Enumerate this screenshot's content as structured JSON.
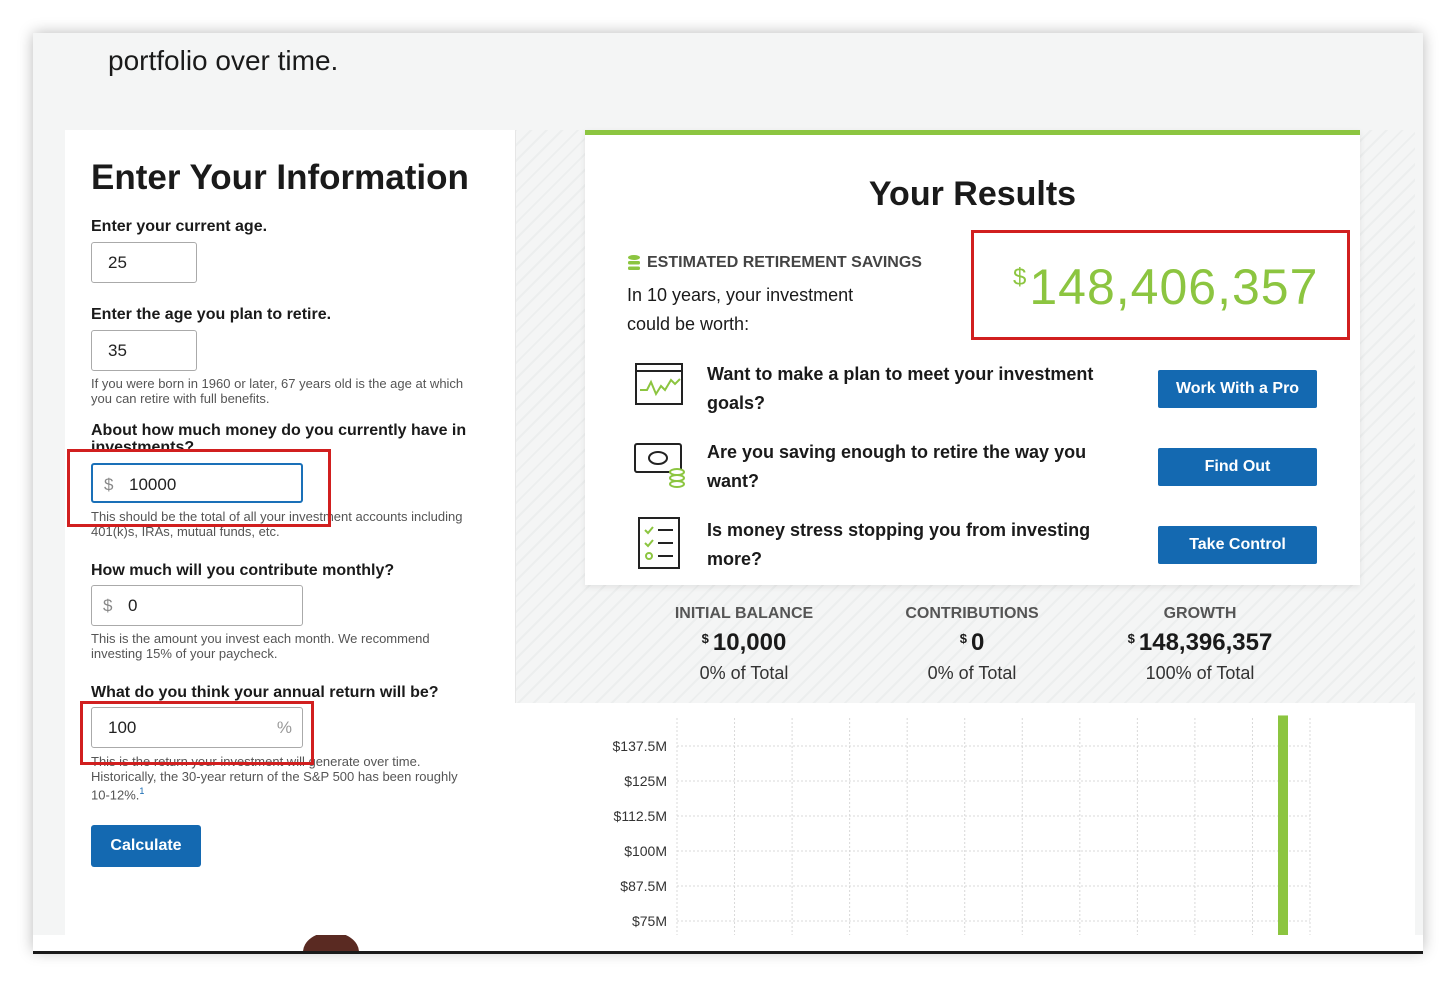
{
  "intro_text": "portfolio over time.",
  "form": {
    "title": "Enter Your Information",
    "age_label": "Enter your current age.",
    "age_value": "25",
    "retire_label": "Enter the age you plan to retire.",
    "retire_value": "35",
    "retire_help": "If you were born in 1960 or later, 67 years old is the age at which you can retire with full benefits.",
    "current_label": "About how much money do you currently have in investments?",
    "currency_symbol": "$",
    "current_value": "10000",
    "current_help": "This should be the total of all your investment accounts including 401(k)s, IRAs, mutual funds, etc.",
    "monthly_label": "How much will you contribute monthly?",
    "monthly_value": "0",
    "monthly_help": "This is the amount you invest each month. We recommend investing 15% of your paycheck.",
    "return_label": "What do you think your annual return will be?",
    "return_value": "100",
    "percent_symbol": "%",
    "return_help": "This is the return your investment will generate over time. Historically, the 30-year return of the S&P 500 has been roughly 10-12%.",
    "footnote": "1",
    "calculate_label": "Calculate"
  },
  "results": {
    "title": "Your Results",
    "estimate_label": "ESTIMATED RETIREMENT SAVINGS",
    "estimate_text": "In 10 years, your investment could be worth:",
    "currency_symbol": "$",
    "amount": "148,406,357",
    "ctas": [
      {
        "text": "Want to make a plan to meet your investment goals?",
        "button": "Work With a Pro",
        "icon": "chart-board-icon"
      },
      {
        "text": "Are you saving enough to retire the way you want?",
        "button": "Find Out",
        "icon": "cash-coins-icon"
      },
      {
        "text": "Is money stress stopping you from investing more?",
        "button": "Take Control",
        "icon": "checklist-icon"
      }
    ]
  },
  "stats": [
    {
      "label": "INITIAL BALANCE",
      "symbol": "$",
      "value": "10,000",
      "pct": "0% of Total"
    },
    {
      "label": "CONTRIBUTIONS",
      "symbol": "$",
      "value": "0",
      "pct": "0% of Total"
    },
    {
      "label": "GROWTH",
      "symbol": "$",
      "value": "148,396,357",
      "pct": "100% of Total"
    }
  ],
  "chart_data": {
    "type": "bar",
    "ytick_labels": [
      "$137.5M",
      "$125M",
      "$112.5M",
      "$100M",
      "$87.5M",
      "$75M"
    ],
    "series": [
      {
        "values": [
          148.406357
        ]
      }
    ],
    "y_unit": "millions of dollars",
    "bar_color": "#8cc540",
    "grid": true
  },
  "colors": {
    "accent_green": "#8cc540",
    "button_blue": "#1469b1",
    "highlight_red": "#d11f1f"
  },
  "banner": {
    "name": "",
    "handle": "",
    "right": ""
  }
}
